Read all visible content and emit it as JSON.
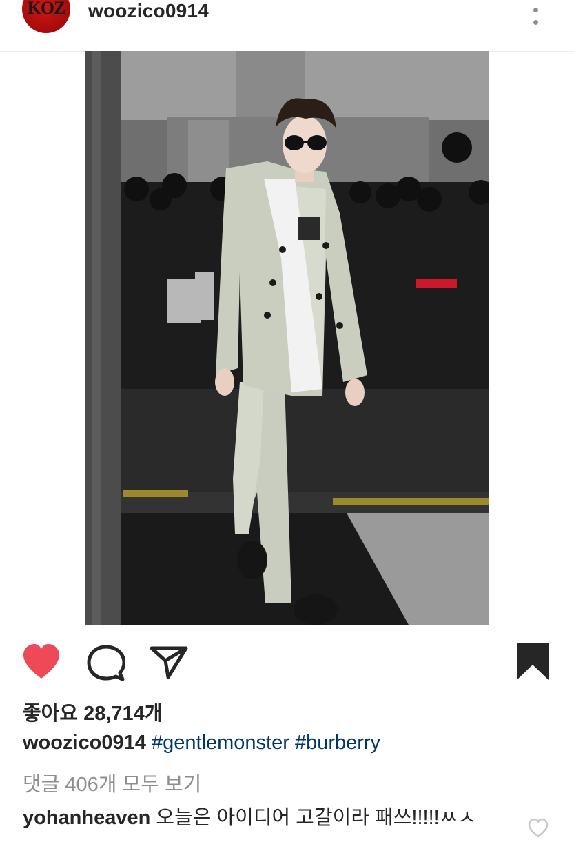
{
  "header": {
    "avatar_text": "KOZ",
    "username": "woozico0914",
    "more_icon": "vertical-ellipsis-icon"
  },
  "post": {
    "image_description": "photo"
  },
  "actions": {
    "like_icon": "heart-filled-icon",
    "comment_icon": "speech-bubble-icon",
    "share_icon": "paper-plane-icon",
    "save_icon": "bookmark-filled-icon",
    "like_color": "#ed4956"
  },
  "likes": {
    "text": "좋아요 28,714개"
  },
  "caption": {
    "username": "woozico0914",
    "tags": [
      "#gentlemonster",
      "#burberry"
    ]
  },
  "comments": {
    "view_all": "댓글 406개 모두 보기",
    "first": {
      "username": "yohanheaven",
      "text": "오늘은 아이디어 고갈이라 패쓰!!!!!ㅆㅅ"
    }
  },
  "colors": {
    "text": "#262626",
    "muted": "#8e8e8e",
    "hashtag": "#003569",
    "heart": "#ed4956"
  }
}
